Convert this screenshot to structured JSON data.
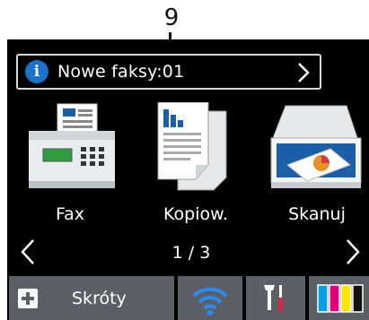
{
  "callout": {
    "number": "9"
  },
  "notification": {
    "icon": "info-icon",
    "text": "Nowe faksy:01",
    "arrow": "chevron-right-icon"
  },
  "tiles": [
    {
      "label": "Fax",
      "icon": "fax-icon"
    },
    {
      "label": "Kopiow.",
      "icon": "copy-icon"
    },
    {
      "label": "Skanuj",
      "icon": "scan-icon"
    }
  ],
  "pager": {
    "indicator": "1 / 3"
  },
  "bottom_bar": {
    "shortcuts_label": "Skróty",
    "wifi_icon": "wifi-icon",
    "settings_icon": "settings-tools-icon",
    "ink_icon": "ink-levels-icon"
  },
  "colors": {
    "screen_bg": "#000000",
    "button_bg": "#5b6066",
    "info_blue": "#1a73c9",
    "wifi_blue": "#2a8cf0",
    "ink_cyan": "#00a0e6",
    "ink_magenta": "#e6007e",
    "ink_yellow": "#ffe600",
    "ink_black": "#111111"
  }
}
